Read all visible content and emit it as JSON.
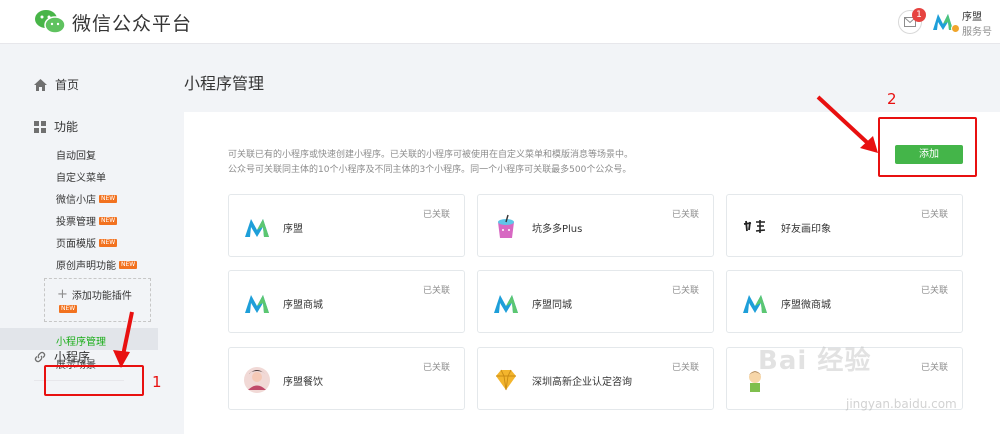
{
  "header": {
    "brand": "微信公众平台",
    "mail_count": "1",
    "account_name": "序盟",
    "account_type": "服务号"
  },
  "sidebar": {
    "home": "首页",
    "function": "功能",
    "function_items": [
      {
        "label": "自动回复",
        "new": ""
      },
      {
        "label": "自定义菜单",
        "new": ""
      },
      {
        "label": "微信小店",
        "new": "NEW"
      },
      {
        "label": "投票管理",
        "new": "NEW"
      },
      {
        "label": "页面模版",
        "new": "NEW"
      },
      {
        "label": "原创声明功能",
        "new": "NEW"
      }
    ],
    "add_plugin": "添加功能插件",
    "add_plugin_new": "NEW",
    "mini_program": "小程序",
    "mini_manage": "小程序管理",
    "mini_scene": "展示场景"
  },
  "main": {
    "title": "小程序管理",
    "desc_line1": "可关联已有的小程序或快速创建小程序。已关联的小程序可被使用在自定义菜单和模版消息等场景中。",
    "desc_line2": "公众号可关联同主体的10个小程序及不同主体的3个小程序。同一个小程序可关联最多500个公众号。",
    "add_button": "添加",
    "cards": [
      {
        "name": "序盟",
        "status": "已关联",
        "icon": "xumeng-logo-icon"
      },
      {
        "name": "坑多多Plus",
        "status": "已关联",
        "icon": "drink-cup-icon"
      },
      {
        "name": "好友画印象",
        "status": "已关联",
        "icon": "calligraphy-icon"
      },
      {
        "name": "序盟商城",
        "status": "已关联",
        "icon": "xumeng-logo-icon"
      },
      {
        "name": "序盟同城",
        "status": "已关联",
        "icon": "xumeng-logo-icon"
      },
      {
        "name": "序盟微商城",
        "status": "已关联",
        "icon": "xumeng-logo-icon"
      },
      {
        "name": "序盟餐饮",
        "status": "已关联",
        "icon": "avatar-photo-icon"
      },
      {
        "name": "深圳高新企业认定咨询",
        "status": "已关联",
        "icon": "diamond-icon"
      },
      {
        "name": "",
        "status": "已关联",
        "icon": "cartoon-avatar-icon"
      }
    ]
  },
  "annotations": {
    "step1": "1",
    "step2": "2"
  },
  "watermark": {
    "text": "Bai 经验",
    "url": "jingyan.baidu.com"
  },
  "colors": {
    "accent_green": "#44b549",
    "active_green": "#1aad19",
    "annotation_red": "#e81010",
    "badge_red": "#e64340"
  }
}
